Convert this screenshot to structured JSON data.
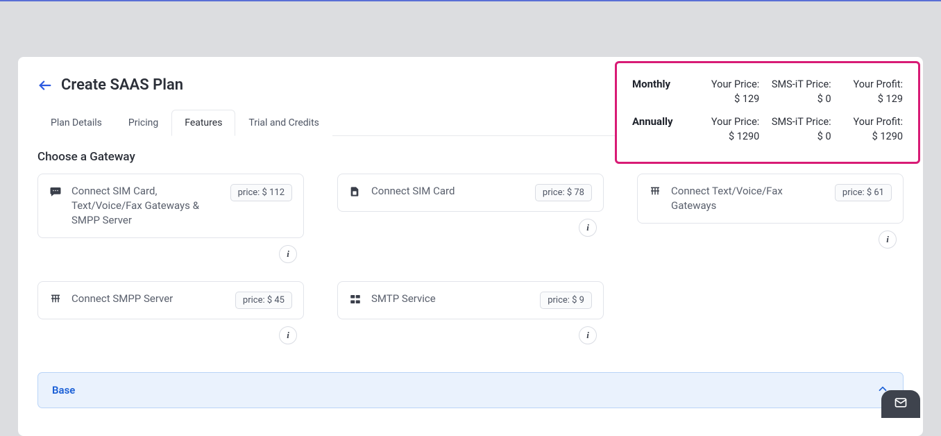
{
  "header": {
    "title": "Create SAAS Plan"
  },
  "tabs": [
    {
      "label": "Plan Details",
      "active": false
    },
    {
      "label": "Pricing",
      "active": false
    },
    {
      "label": "Features",
      "active": true
    },
    {
      "label": "Trial and Credits",
      "active": false
    }
  ],
  "section_title": "Choose a Gateway",
  "gateways": [
    {
      "label": "Connect SIM Card, Text/Voice/Fax Gateways & SMPP Server",
      "price": "price: $ 112",
      "icon": "chat-bubble"
    },
    {
      "label": "Connect SIM Card",
      "price": "price: $ 78",
      "icon": "sim-card"
    },
    {
      "label": "Connect Text/Voice/Fax Gateways",
      "price": "price: $ 61",
      "icon": "gateway"
    },
    {
      "label": "Connect SMPP Server",
      "price": "price: $ 45",
      "icon": "gateway"
    },
    {
      "label": "SMTP Service",
      "price": "price: $ 9",
      "icon": "server-stack"
    }
  ],
  "summary": {
    "rows": [
      {
        "period": "Monthly",
        "your_price_label": "Your Price:",
        "your_price_value": "$ 129",
        "smsit_label": "SMS-iT Price:",
        "smsit_value": "$ 0",
        "profit_label": "Your Profit:",
        "profit_value": "$ 129"
      },
      {
        "period": "Annually",
        "your_price_label": "Your Price:",
        "your_price_value": "$ 1290",
        "smsit_label": "SMS-iT Price:",
        "smsit_value": "$ 0",
        "profit_label": "Your Profit:",
        "profit_value": "$ 1290"
      }
    ]
  },
  "accordion": {
    "label": "Base"
  }
}
